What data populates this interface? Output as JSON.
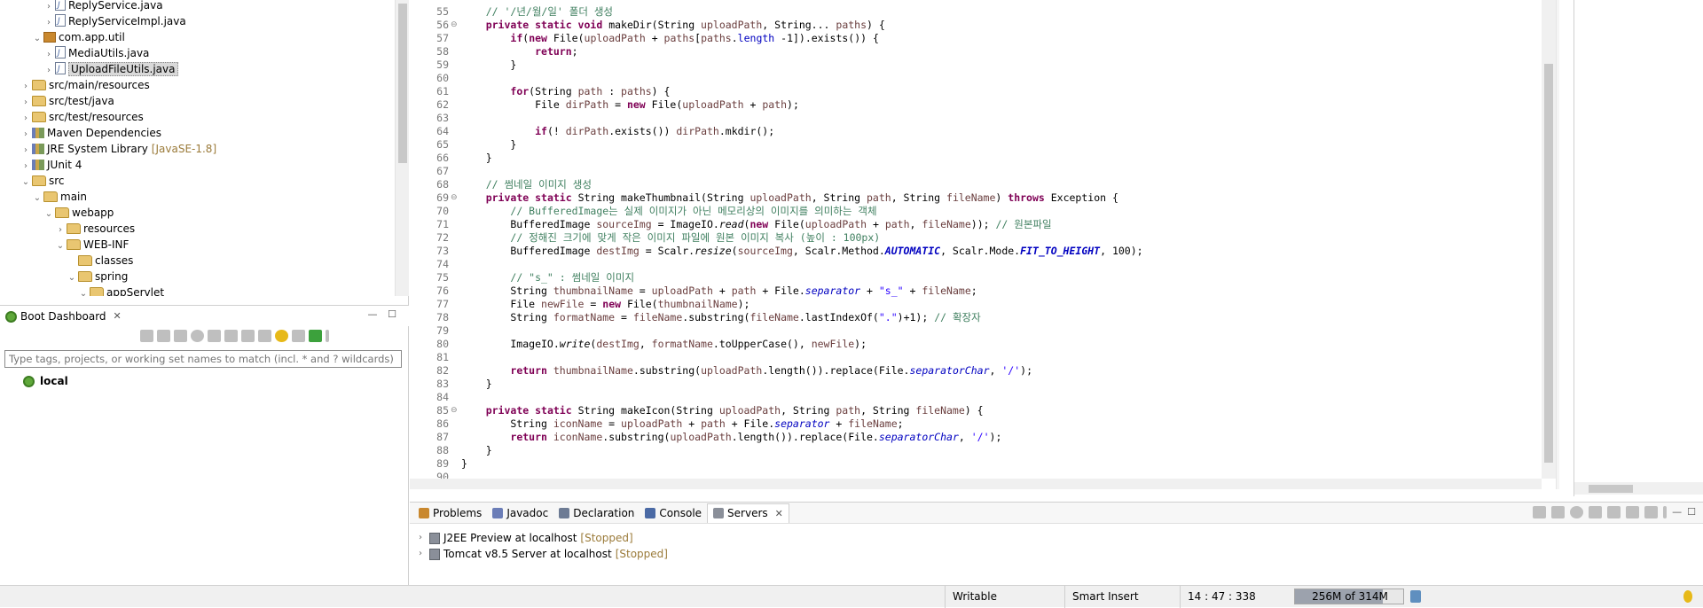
{
  "project_explorer": {
    "items": [
      {
        "label": "ReplyService.java",
        "icon": "java-file-icon",
        "twisty": "›"
      },
      {
        "label": "ReplyServiceImpl.java",
        "icon": "java-file-icon",
        "twisty": "›"
      },
      {
        "label": "com.app.util",
        "icon": "package-icon",
        "twisty": "⌄"
      },
      {
        "label": "MediaUtils.java",
        "icon": "java-file-icon",
        "twisty": "›"
      },
      {
        "label": "UploadFileUtils.java",
        "icon": "java-file-icon",
        "twisty": "›",
        "selected": true
      },
      {
        "label": "src/main/resources",
        "icon": "source-folder-icon",
        "twisty": "›"
      },
      {
        "label": "src/test/java",
        "icon": "source-folder-icon",
        "twisty": "›"
      },
      {
        "label": "src/test/resources",
        "icon": "source-folder-icon",
        "twisty": "›"
      },
      {
        "label": "Maven Dependencies",
        "icon": "library-icon",
        "twisty": "›"
      },
      {
        "label": "JRE System Library",
        "decoration": "[JavaSE-1.8]",
        "icon": "library-icon",
        "twisty": "›"
      },
      {
        "label": "JUnit 4",
        "icon": "library-icon",
        "twisty": "›"
      },
      {
        "label": "src",
        "icon": "folder-icon",
        "twisty": "⌄"
      },
      {
        "label": "main",
        "icon": "folder-icon",
        "twisty": "⌄"
      },
      {
        "label": "webapp",
        "icon": "folder-icon",
        "twisty": "⌄"
      },
      {
        "label": "resources",
        "icon": "folder-icon",
        "twisty": "›"
      },
      {
        "label": "WEB-INF",
        "icon": "folder-icon",
        "twisty": "⌄"
      },
      {
        "label": "classes",
        "icon": "folder-icon",
        "twisty": ""
      },
      {
        "label": "spring",
        "icon": "folder-icon",
        "twisty": "⌄"
      },
      {
        "label": "appServlet",
        "icon": "folder-icon",
        "twisty": "⌄"
      }
    ]
  },
  "boot_dashboard": {
    "tab_label": "Boot Dashboard",
    "filter_placeholder": "Type tags, projects, or working set names to match (incl. * and ? wildcards)",
    "local_label": "local"
  },
  "editor": {
    "lines": [
      {
        "n": "55",
        "h": "    <span class=\"cm\">// '/년/월/일' 폴더 생성</span>"
      },
      {
        "n": "56",
        "fold": "⊖",
        "h": "    <span class=\"kw\">private static void</span> makeDir(String <span class=\"pa\">uploadPath</span>, String... <span class=\"pa\">paths</span>) {"
      },
      {
        "n": "57",
        "h": "        <span class=\"kw\">if</span>(<span class=\"kw\">new</span> File(<span class=\"pa\">uploadPath</span> + <span class=\"pa\">paths</span>[<span class=\"pa\">paths</span>.<span class=\"fd\">length</span> -1]).exists()) {"
      },
      {
        "n": "58",
        "h": "            <span class=\"kw\">return</span>;"
      },
      {
        "n": "59",
        "h": "        }"
      },
      {
        "n": "60",
        "h": ""
      },
      {
        "n": "61",
        "h": "        <span class=\"kw\">for</span>(String <span class=\"pa\">path</span> : <span class=\"pa\">paths</span>) {"
      },
      {
        "n": "62",
        "h": "            File <span class=\"pa\">dirPath</span> = <span class=\"kw\">new</span> File(<span class=\"pa\">uploadPath</span> + <span class=\"pa\">path</span>);"
      },
      {
        "n": "63",
        "h": ""
      },
      {
        "n": "64",
        "h": "            <span class=\"kw\">if</span>(! <span class=\"pa\">dirPath</span>.exists()) <span class=\"pa\">dirPath</span>.mkdir();"
      },
      {
        "n": "65",
        "h": "        }"
      },
      {
        "n": "66",
        "h": "    }"
      },
      {
        "n": "67",
        "h": ""
      },
      {
        "n": "68",
        "h": "    <span class=\"cm\">// 썸네일 이미지 생성</span>"
      },
      {
        "n": "69",
        "fold": "⊖",
        "h": "    <span class=\"kw\">private static</span> String makeThumbnail(String <span class=\"pa\">uploadPath</span>, String <span class=\"pa\">path</span>, String <span class=\"pa\">fileName</span>) <span class=\"kw\">throws</span> Exception {"
      },
      {
        "n": "70",
        "h": "        <span class=\"cm\">// BufferedImage는 실제 이미지가 아닌 메모리상의 이미지를 의미하는 객체</span>"
      },
      {
        "n": "71",
        "h": "        BufferedImage <span class=\"pa\">sourceImg</span> = ImageIO.<span class=\"mi\">read</span>(<span class=\"kw\">new</span> File(<span class=\"pa\">uploadPath</span> + <span class=\"pa\">path</span>, <span class=\"pa\">fileName</span>)); <span class=\"cm\">// 원본파일</span>"
      },
      {
        "n": "72",
        "h": "        <span class=\"cm\">// 정해진 크기에 맞게 작은 이미지 파일에 원본 이미지 복사 (높이 : 100px)</span>"
      },
      {
        "n": "73",
        "h": "        BufferedImage <span class=\"pa\">destImg</span> = Scalr.<span class=\"mi\">resize</span>(<span class=\"pa\">sourceImg</span>, Scalr.Method.<span class=\"fb\">AUTOMATIC</span>, Scalr.Mode.<span class=\"fb\">FIT_TO_HEIGHT</span>, 100);"
      },
      {
        "n": "74",
        "h": ""
      },
      {
        "n": "75",
        "h": "        <span class=\"cm\">// \"s_\" : 썸네일 이미지</span>"
      },
      {
        "n": "76",
        "h": "        String <span class=\"pa\">thumbnailName</span> = <span class=\"pa\">uploadPath</span> + <span class=\"pa\">path</span> + File.<span class=\"fi\">separator</span> + <span class=\"st\">\"s_\"</span> + <span class=\"pa\">fileName</span>;"
      },
      {
        "n": "77",
        "h": "        File <span class=\"pa\">newFile</span> = <span class=\"kw\">new</span> File(<span class=\"pa\">thumbnailName</span>);"
      },
      {
        "n": "78",
        "h": "        String <span class=\"pa\">formatName</span> = <span class=\"pa\">fileName</span>.substring(<span class=\"pa\">fileName</span>.lastIndexOf(<span class=\"st\">\".\"</span>)+1); <span class=\"cm\">// 확장자</span>"
      },
      {
        "n": "79",
        "h": ""
      },
      {
        "n": "80",
        "h": "        ImageIO.<span class=\"mi\">write</span>(<span class=\"pa\">destImg</span>, <span class=\"pa\">formatName</span>.toUpperCase(), <span class=\"pa\">newFile</span>);"
      },
      {
        "n": "81",
        "h": ""
      },
      {
        "n": "82",
        "h": "        <span class=\"kw\">return</span> <span class=\"pa\">thumbnailName</span>.substring(<span class=\"pa\">uploadPath</span>.length()).replace(File.<span class=\"fi\">separatorChar</span>, <span class=\"st\">'/'</span>);"
      },
      {
        "n": "83",
        "h": "    }"
      },
      {
        "n": "84",
        "h": ""
      },
      {
        "n": "85",
        "fold": "⊖",
        "h": "    <span class=\"kw\">private static</span> String makeIcon(String <span class=\"pa\">uploadPath</span>, String <span class=\"pa\">path</span>, String <span class=\"pa\">fileName</span>) {"
      },
      {
        "n": "86",
        "h": "        String <span class=\"pa\">iconName</span> = <span class=\"pa\">uploadPath</span> + <span class=\"pa\">path</span> + File.<span class=\"fi\">separator</span> + <span class=\"pa\">fileName</span>;"
      },
      {
        "n": "87",
        "h": "        <span class=\"kw\">return</span> <span class=\"pa\">iconName</span>.substring(<span class=\"pa\">uploadPath</span>.length()).replace(File.<span class=\"fi\">separatorChar</span>, <span class=\"st\">'/'</span>);"
      },
      {
        "n": "88",
        "h": "    }"
      },
      {
        "n": "89",
        "h": "}"
      },
      {
        "n": "90",
        "h": ""
      }
    ]
  },
  "bottom_view": {
    "tabs": [
      {
        "label": "Problems",
        "icon": "problems-icon"
      },
      {
        "label": "Javadoc",
        "icon": "javadoc-icon"
      },
      {
        "label": "Declaration",
        "icon": "declaration-icon"
      },
      {
        "label": "Console",
        "icon": "console-icon"
      },
      {
        "label": "Servers",
        "icon": "servers-icon",
        "active": true
      }
    ],
    "servers": [
      {
        "name": "J2EE Preview at localhost",
        "status": "[Stopped]"
      },
      {
        "name": "Tomcat v8.5 Server at localhost",
        "status": "[Stopped]"
      }
    ]
  },
  "status_bar": {
    "writable": "Writable",
    "insert_mode": "Smart Insert",
    "position": "14 : 47 : 338",
    "heap": "256M of 314M",
    "heap_fraction": 0.815
  },
  "colors": {
    "keyword": "#7f0055",
    "comment": "#3f7f5f",
    "string": "#2a00ff",
    "field": "#0000c0",
    "decoration": "#9b7b3a"
  }
}
